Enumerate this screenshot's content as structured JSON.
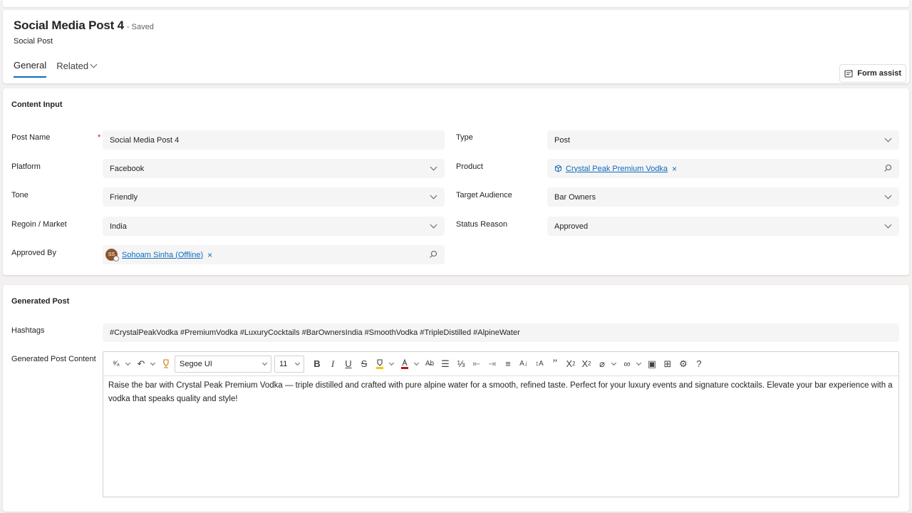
{
  "header": {
    "title": "Social Media Post 4",
    "saved_status": "- Saved",
    "entity_type": "Social Post",
    "tabs": [
      {
        "label": "General"
      },
      {
        "label": "Related"
      }
    ],
    "form_assist_label": "Form assist"
  },
  "content_input": {
    "section_title": "Content Input",
    "post_name": {
      "label": "Post Name",
      "required_mark": "*",
      "value": "Social Media Post 4"
    },
    "platform": {
      "label": "Platform",
      "value": "Facebook"
    },
    "tone": {
      "label": "Tone",
      "value": "Friendly"
    },
    "region": {
      "label": "Regoin / Market",
      "value": "India"
    },
    "approved_by": {
      "label": "Approved By",
      "avatar_initials": "SS",
      "value": "Sohoam Sinha (Offline)",
      "avatar_color": "#8e562e"
    },
    "type": {
      "label": "Type",
      "value": "Post"
    },
    "product": {
      "label": "Product",
      "value": "Crystal Peak Premium Vodka"
    },
    "target_audience": {
      "label": "Target Audience",
      "value": "Bar Owners"
    },
    "status_reason": {
      "label": "Status Reason",
      "value": "Approved"
    }
  },
  "generated_post": {
    "section_title": "Generated Post",
    "hashtags": {
      "label": "Hashtags",
      "value": "#CrystalPeakVodka #PremiumVodka #LuxuryCocktails #BarOwnersIndia #SmoothVodka #TripleDistilled #AlpineWater"
    },
    "content": {
      "label": "Generated Post Content",
      "font_name": "Segoe UI",
      "font_size": "11",
      "text": "Raise the bar with Crystal Peak Premium Vodka — triple distilled and crafted with pure alpine water for a smooth, refined taste. Perfect for your luxury events and signature cocktails. Elevate your bar experience with a vodka that speaks quality and style!"
    }
  },
  "colors": {
    "accent": "#0f6cbd",
    "required": "#c50f1f",
    "field_bg": "#f5f5f5",
    "font_color_swatch": "#c50f1f",
    "highlight_swatch": "#f7c600"
  }
}
